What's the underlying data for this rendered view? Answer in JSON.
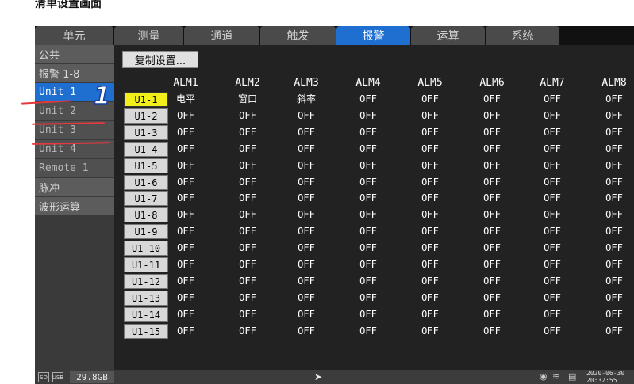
{
  "caption": "清单设置画面",
  "tabs": [
    {
      "label": "单元",
      "active": false
    },
    {
      "label": "测量",
      "active": false
    },
    {
      "label": "通道",
      "active": false
    },
    {
      "label": "触发",
      "active": false
    },
    {
      "label": "报警",
      "active": true
    },
    {
      "label": "运算",
      "active": false
    },
    {
      "label": "系统",
      "active": false
    }
  ],
  "sidebar": [
    {
      "label": "公共",
      "state": "normal"
    },
    {
      "label": "报警 1-8",
      "state": "normal"
    },
    {
      "label": "Unit 1",
      "state": "active"
    },
    {
      "label": "Unit 2",
      "state": "dim"
    },
    {
      "label": "Unit 3",
      "state": "dim"
    },
    {
      "label": "Unit 4",
      "state": "dim"
    },
    {
      "label": "Remote 1",
      "state": "dim"
    },
    {
      "label": "脉冲",
      "state": "normal"
    },
    {
      "label": "波形运算",
      "state": "normal"
    }
  ],
  "copy_button": "复制设置...",
  "columns": [
    "ALM1",
    "ALM2",
    "ALM3",
    "ALM4",
    "ALM5",
    "ALM6",
    "ALM7",
    "ALM8"
  ],
  "rows": [
    {
      "label": "U1-1",
      "selected": true,
      "values": [
        "电平",
        "窗口",
        "斜率",
        "OFF",
        "OFF",
        "OFF",
        "OFF",
        "OFF"
      ]
    },
    {
      "label": "U1-2",
      "selected": false,
      "values": [
        "OFF",
        "OFF",
        "OFF",
        "OFF",
        "OFF",
        "OFF",
        "OFF",
        "OFF"
      ]
    },
    {
      "label": "U1-3",
      "selected": false,
      "values": [
        "OFF",
        "OFF",
        "OFF",
        "OFF",
        "OFF",
        "OFF",
        "OFF",
        "OFF"
      ]
    },
    {
      "label": "U1-4",
      "selected": false,
      "values": [
        "OFF",
        "OFF",
        "OFF",
        "OFF",
        "OFF",
        "OFF",
        "OFF",
        "OFF"
      ]
    },
    {
      "label": "U1-5",
      "selected": false,
      "values": [
        "OFF",
        "OFF",
        "OFF",
        "OFF",
        "OFF",
        "OFF",
        "OFF",
        "OFF"
      ]
    },
    {
      "label": "U1-6",
      "selected": false,
      "values": [
        "OFF",
        "OFF",
        "OFF",
        "OFF",
        "OFF",
        "OFF",
        "OFF",
        "OFF"
      ]
    },
    {
      "label": "U1-7",
      "selected": false,
      "values": [
        "OFF",
        "OFF",
        "OFF",
        "OFF",
        "OFF",
        "OFF",
        "OFF",
        "OFF"
      ]
    },
    {
      "label": "U1-8",
      "selected": false,
      "values": [
        "OFF",
        "OFF",
        "OFF",
        "OFF",
        "OFF",
        "OFF",
        "OFF",
        "OFF"
      ]
    },
    {
      "label": "U1-9",
      "selected": false,
      "values": [
        "OFF",
        "OFF",
        "OFF",
        "OFF",
        "OFF",
        "OFF",
        "OFF",
        "OFF"
      ]
    },
    {
      "label": "U1-10",
      "selected": false,
      "values": [
        "OFF",
        "OFF",
        "OFF",
        "OFF",
        "OFF",
        "OFF",
        "OFF",
        "OFF"
      ]
    },
    {
      "label": "U1-11",
      "selected": false,
      "values": [
        "OFF",
        "OFF",
        "OFF",
        "OFF",
        "OFF",
        "OFF",
        "OFF",
        "OFF"
      ]
    },
    {
      "label": "U1-12",
      "selected": false,
      "values": [
        "OFF",
        "OFF",
        "OFF",
        "OFF",
        "OFF",
        "OFF",
        "OFF",
        "OFF"
      ]
    },
    {
      "label": "U1-13",
      "selected": false,
      "values": [
        "OFF",
        "OFF",
        "OFF",
        "OFF",
        "OFF",
        "OFF",
        "OFF",
        "OFF"
      ]
    },
    {
      "label": "U1-14",
      "selected": false,
      "values": [
        "OFF",
        "OFF",
        "OFF",
        "OFF",
        "OFF",
        "OFF",
        "OFF",
        "OFF"
      ]
    },
    {
      "label": "U1-15",
      "selected": false,
      "values": [
        "OFF",
        "OFF",
        "OFF",
        "OFF",
        "OFF",
        "OFF",
        "OFF",
        "OFF"
      ]
    }
  ],
  "status": {
    "sd_icon": "SD",
    "usb_icon": "USB",
    "storage": "29.8GB",
    "date": "2020-06-30",
    "time": "20:32:55"
  },
  "annotation": {
    "step": "1"
  },
  "colors": {
    "accent": "#1e6fd0",
    "selected_row": "#f2ef1a",
    "annotation_red": "#e8383d"
  },
  "icons": [
    "sd-card-icon",
    "usb-icon",
    "pointer-icon",
    "wifi-icon",
    "battery-icon"
  ]
}
